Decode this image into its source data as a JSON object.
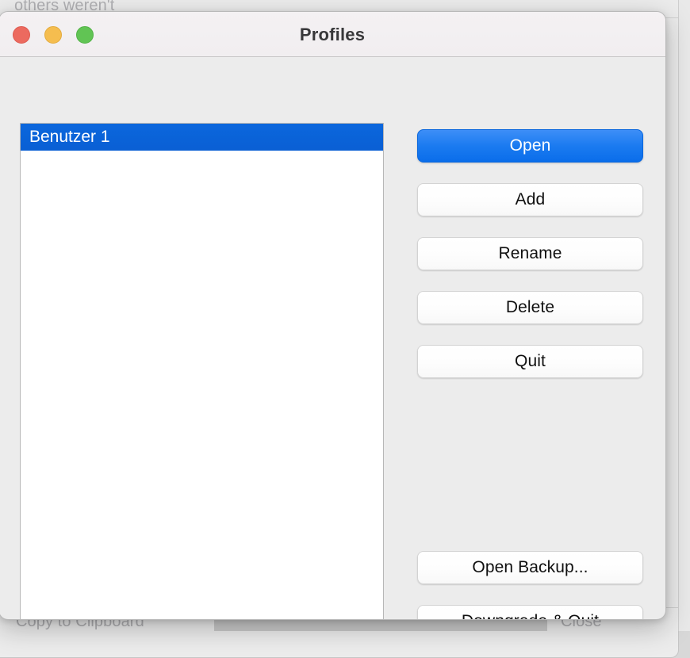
{
  "background": {
    "top_text": "others weren't",
    "copy_button_label": "Copy to Clipboard",
    "close_button_label": "Close"
  },
  "dialog": {
    "title": "Profiles",
    "window_controls": {
      "close_label": "close-window",
      "minimize_label": "minimize-window",
      "zoom_label": "zoom-window"
    },
    "profile_list": {
      "items": [
        {
          "label": "Benutzer 1",
          "selected": true
        }
      ]
    },
    "buttons": {
      "open": "Open",
      "add": "Add",
      "rename": "Rename",
      "delete": "Delete",
      "quit": "Quit",
      "open_backup": "Open Backup...",
      "downgrade_quit": "Downgrade & Quit"
    }
  },
  "colors": {
    "accent_blue": "#0a6dea",
    "selection_blue": "#0a5fd4",
    "dialog_background": "#ececec",
    "titlebar_background": "#f2eff1",
    "traffic_red": "#ec6a5f",
    "traffic_yellow": "#f5bd4f",
    "traffic_green": "#61c454"
  }
}
